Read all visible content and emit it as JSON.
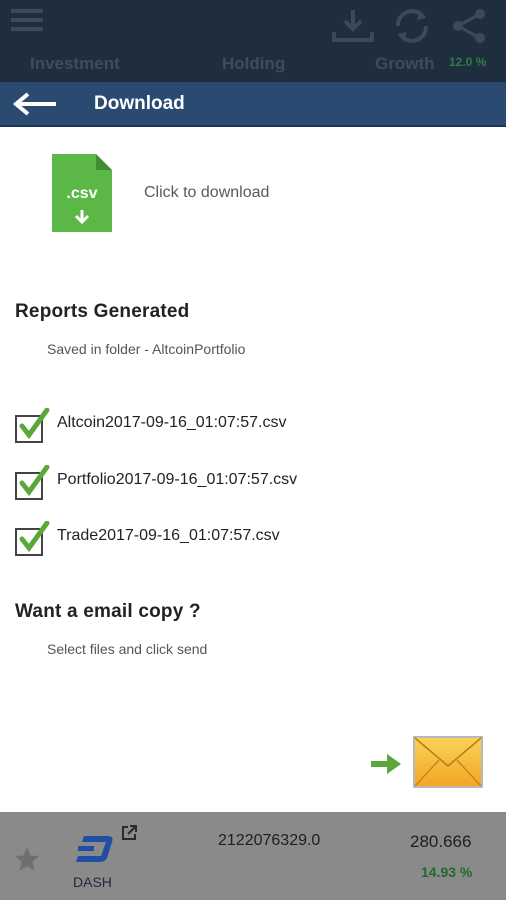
{
  "topbar": {
    "menu_icon": "hamburger-icon",
    "icons": [
      "download-icon",
      "refresh-icon",
      "share-icon"
    ],
    "tabs": [
      "Investment",
      "Holding",
      "Growth"
    ],
    "growth_percent": "12.0 %"
  },
  "header": {
    "back_icon": "back-arrow-icon",
    "title": "Download"
  },
  "download": {
    "file_icon_label": ".csv",
    "click_text": "Click to download"
  },
  "reports": {
    "title": "Reports Generated",
    "saved_text": "Saved in folder - AltcoinPortfolio",
    "files": [
      {
        "name": "Altcoin2017-09-16_01:07:57.csv",
        "checked": true
      },
      {
        "name": "Portfolio2017-09-16_01:07:57.csv",
        "checked": true
      },
      {
        "name": "Trade2017-09-16_01:07:57.csv",
        "checked": true
      }
    ]
  },
  "email": {
    "title": "Want a email copy ?",
    "instruction": "Select files and click send",
    "send_icon": "envelope-icon"
  },
  "coin_row": {
    "name": "DASH",
    "amount": "2122076329.0",
    "price": "280.666",
    "change": "14.93 %"
  },
  "colors": {
    "header_bg": "#2b4a72",
    "topbar_bg": "#1f2e3e",
    "csv_green": "#5bb847",
    "check_green": "#5aa73a",
    "envelope_orange": "#f5b731"
  }
}
